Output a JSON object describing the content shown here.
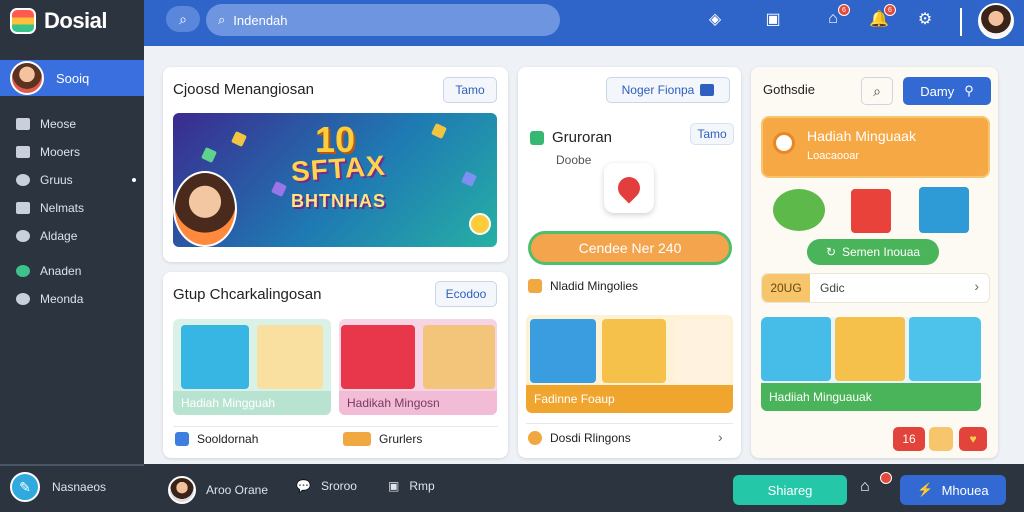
{
  "app": {
    "title": "Dosial"
  },
  "sidebar": {
    "profile_name": "Sooiq",
    "items": [
      {
        "label": "Meose"
      },
      {
        "label": "Mooers"
      },
      {
        "label": "Gruus"
      },
      {
        "label": "Nelmats"
      },
      {
        "label": "Aldage"
      },
      {
        "label": "Anaden"
      },
      {
        "label": "Meonda"
      }
    ],
    "bottom_label": "Nasnaeos"
  },
  "topbar": {
    "search_placeholder": "Indendah",
    "notif_badge_1": "6",
    "notif_badge_2": "6"
  },
  "card1": {
    "title": "Cjoosd Menangiosan",
    "button": "Tamo",
    "hero_number": "10",
    "hero_title": "SFTAX",
    "hero_subtitle": "BHTNHAS"
  },
  "card2": {
    "title": "Gtup Chcarkalingosan",
    "button": "Ecodoo",
    "tiles": [
      {
        "caption": "Hadiah Mingguah"
      },
      {
        "caption": "Hadikah Mingosn"
      }
    ],
    "footer": [
      {
        "label": "Sooldornah"
      },
      {
        "label": "Grurlers"
      }
    ]
  },
  "card3": {
    "button": "Noger Fionpa",
    "subtitle_title": "Gruroran",
    "subtitle_desc": "Doobe",
    "tag": "Tamo",
    "cta": "Cendee Ner 240",
    "section_title": "Nladid Mingolies",
    "banner": "Fadinne Foaup",
    "footer": "Dosdi Rlingons"
  },
  "card4": {
    "title": "Gothsdie",
    "button": "Damy",
    "weekly_title": "Hadiah Minguaak",
    "weekly_sub": "Loacaooar",
    "claim_button": "Semen Inouaa",
    "progress_value": "20UG",
    "progress_label": "Gdic",
    "banner": "Hadiiah Minguauak",
    "badge_count": "16"
  },
  "bottombar": {
    "user": "Aroo Orane",
    "chat": "Sroroo",
    "help": "Rmp",
    "share_button": "Shiareg",
    "action_button": "Mhouea"
  },
  "colors": {
    "primary": "#2f64c8",
    "sidebar": "#2c3440",
    "accent_orange": "#f0a941",
    "accent_green": "#4ab45a",
    "accent_teal": "#24c8a8"
  }
}
